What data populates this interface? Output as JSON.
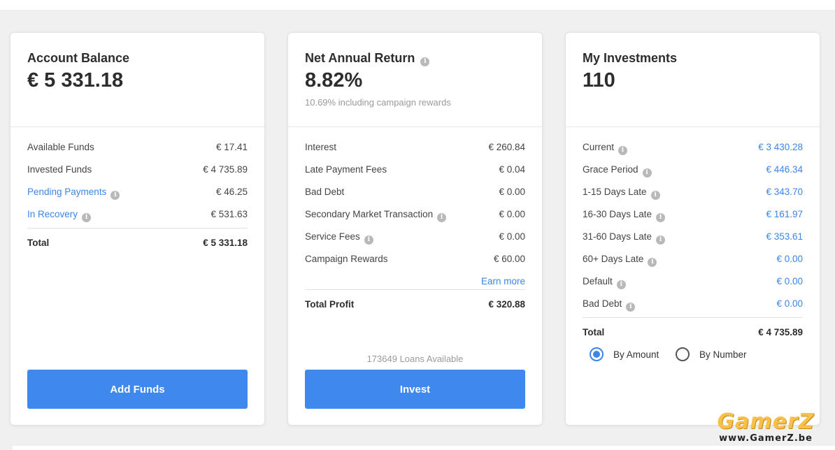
{
  "balance": {
    "title": "Account Balance",
    "value": "€ 5 331.18",
    "rows": [
      {
        "label": "Available Funds",
        "value": "€ 17.41"
      },
      {
        "label": "Invested Funds",
        "value": "€ 4 735.89"
      },
      {
        "label": "Pending Payments",
        "value": "€ 46.25"
      },
      {
        "label": "In Recovery",
        "value": "€ 531.63"
      }
    ],
    "total_label": "Total",
    "total_value": "€ 5 331.18",
    "button": "Add Funds"
  },
  "return": {
    "title": "Net Annual Return",
    "value": "8.82%",
    "note": "10.69% including campaign rewards",
    "rows": [
      {
        "label": "Interest",
        "value": "€ 260.84"
      },
      {
        "label": "Late Payment Fees",
        "value": "€ 0.04"
      },
      {
        "label": "Bad Debt",
        "value": "€ 0.00"
      },
      {
        "label": "Secondary Market Transaction",
        "value": "€ 0.00"
      },
      {
        "label": "Service Fees",
        "value": "€ 0.00"
      },
      {
        "label": "Campaign Rewards",
        "value": "€ 60.00"
      }
    ],
    "earn_more": "Earn more",
    "total_label": "Total Profit",
    "total_value": "€ 320.88",
    "loans_available": "173649 Loans Available",
    "button": "Invest"
  },
  "investments": {
    "title": "My Investments",
    "value": "110",
    "rows": [
      {
        "label": "Current",
        "value": "€ 3 430.28"
      },
      {
        "label": "Grace Period",
        "value": "€ 446.34"
      },
      {
        "label": "1-15 Days Late",
        "value": "€ 343.70"
      },
      {
        "label": "16-30 Days Late",
        "value": "€ 161.97"
      },
      {
        "label": "31-60 Days Late",
        "value": "€ 353.61"
      },
      {
        "label": "60+ Days Late",
        "value": "€ 0.00"
      },
      {
        "label": "Default",
        "value": "€ 0.00"
      },
      {
        "label": "Bad Debt",
        "value": "€ 0.00"
      }
    ],
    "total_label": "Total",
    "total_value": "€ 4 735.89",
    "radio_amount": "By Amount",
    "radio_number": "By Number",
    "selected": "By Amount"
  },
  "info_icon_glyph": "i",
  "watermark": {
    "logo": "GamerZ",
    "url": "www.GamerZ.be"
  },
  "colors": {
    "accent": "#3e88ee",
    "link": "#3d86e8",
    "background": "#f0f0f0"
  }
}
